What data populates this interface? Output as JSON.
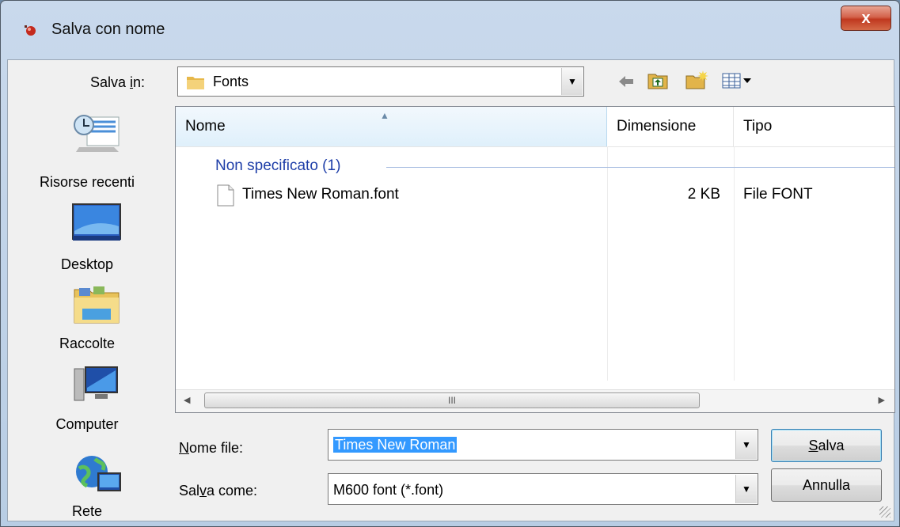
{
  "window": {
    "title": "Salva con nome",
    "close_label": "x"
  },
  "save_in": {
    "label_pre": "Salva ",
    "label_u": "i",
    "label_post": "n:",
    "value": "Fonts"
  },
  "toolbar": {
    "back_icon": "back-arrow-icon",
    "up_icon": "up-folder-icon",
    "new_folder_icon": "new-folder-icon",
    "view_icon": "view-menu-icon"
  },
  "places": [
    {
      "label": "Risorse recenti",
      "icon": "recent-places-icon"
    },
    {
      "label": "Desktop",
      "icon": "desktop-icon"
    },
    {
      "label": "Raccolte",
      "icon": "libraries-icon"
    },
    {
      "label": "Computer",
      "icon": "computer-icon"
    },
    {
      "label": "Rete",
      "icon": "network-icon"
    }
  ],
  "list": {
    "columns": [
      "Nome",
      "Dimensione",
      "Tipo"
    ],
    "group": "Non specificato (1)",
    "rows": [
      {
        "name": "Times New Roman.font",
        "size": "2 KB",
        "type": "File FONT"
      }
    ],
    "scroll_glyph": "III"
  },
  "filename": {
    "label_u": "N",
    "label_post": "ome file:",
    "value": "Times New Roman"
  },
  "filetype": {
    "label_pre": "Sal",
    "label_u": "v",
    "label_post": "a come:",
    "value": "M600 font (*.font)"
  },
  "buttons": {
    "save_u": "S",
    "save_post": "alva",
    "cancel": "Annulla"
  }
}
